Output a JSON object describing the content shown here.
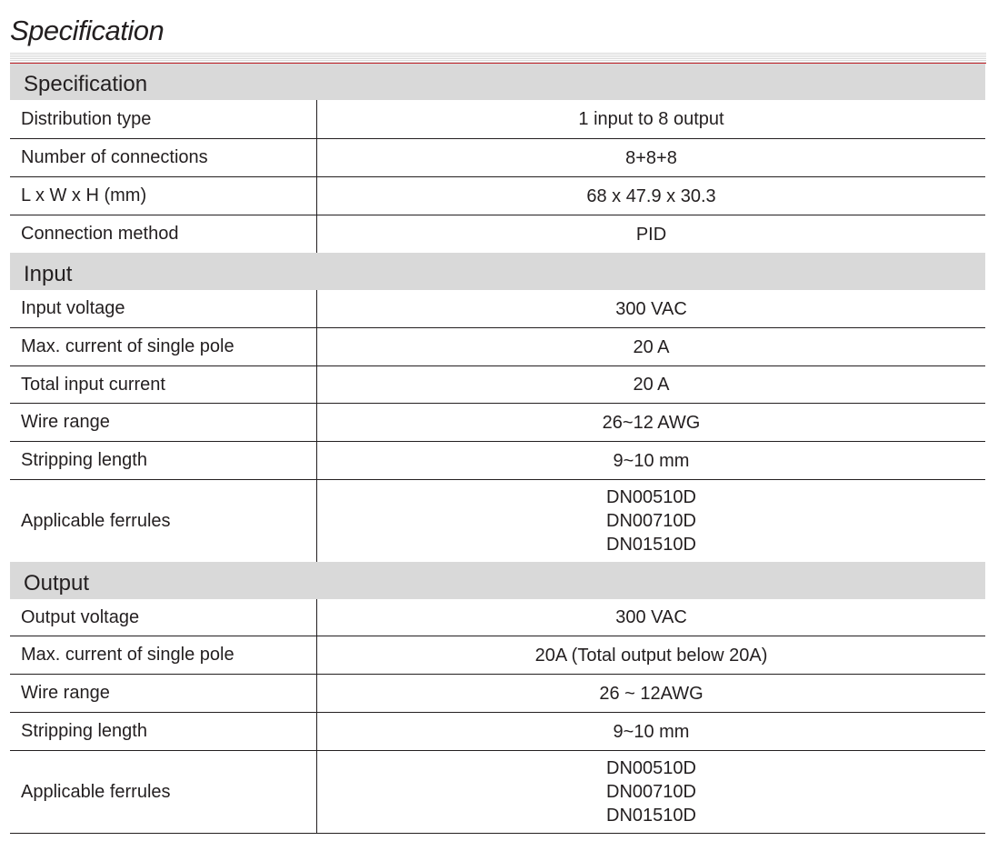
{
  "page": {
    "title": "Specification"
  },
  "sections": [
    {
      "header": "Specification",
      "rows": [
        {
          "label": "Distribution type",
          "values": [
            "1 input to 8 output"
          ]
        },
        {
          "label": "Number of connections",
          "values": [
            "8+8+8"
          ]
        },
        {
          "label": "L x W x H (mm)",
          "values": [
            "68 x 47.9 x 30.3"
          ]
        },
        {
          "label": "Connection method",
          "values": [
            "PID"
          ]
        }
      ]
    },
    {
      "header": "Input",
      "rows": [
        {
          "label": "Input voltage",
          "values": [
            "300 VAC"
          ]
        },
        {
          "label": "Max. current of single pole",
          "values": [
            "20 A"
          ]
        },
        {
          "label": "Total input current",
          "values": [
            "20 A"
          ]
        },
        {
          "label": "Wire range",
          "values": [
            "26~12 AWG"
          ]
        },
        {
          "label": "Stripping length",
          "values": [
            "9~10 mm"
          ]
        },
        {
          "label": "Applicable ferrules",
          "values": [
            "DN00510D",
            "DN00710D",
            "DN01510D"
          ]
        }
      ]
    },
    {
      "header": "Output",
      "rows": [
        {
          "label": "Output voltage",
          "values": [
            "300 VAC"
          ]
        },
        {
          "label": "Max. current of single pole",
          "values": [
            "20A (Total output below 20A)"
          ]
        },
        {
          "label": "Wire range",
          "values": [
            "26 ~ 12AWG"
          ]
        },
        {
          "label": "Stripping length",
          "values": [
            "9~10 mm"
          ]
        },
        {
          "label": "Applicable ferrules",
          "values": [
            "DN00510D",
            "DN00710D",
            "DN01510D"
          ]
        }
      ]
    }
  ]
}
